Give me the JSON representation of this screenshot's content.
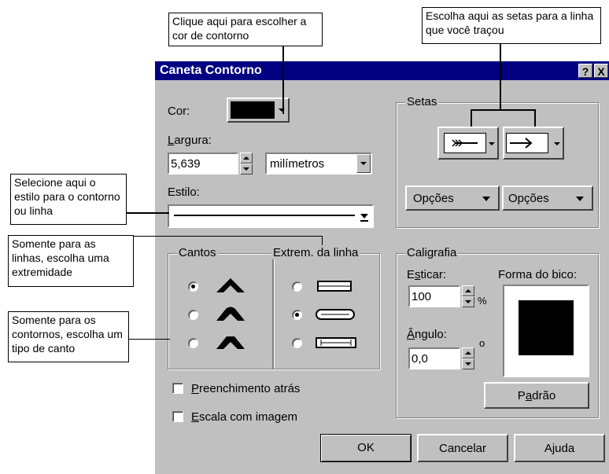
{
  "callouts": {
    "color": "Clique aqui para escolher a cor de contorno",
    "arrows": "Escolha aqui as setas para a linha que você traçou",
    "style": "Selecione aqui o estilo para o contorno ou linha",
    "line_end": "Somente para as linhas, escolha uma extremidade",
    "corner": "Somente para os contornos, escolha um tipo de canto"
  },
  "dialog": {
    "title": "Caneta Contorno",
    "help_btn": "?",
    "close_btn": "X",
    "color_label": "Cor:",
    "color_value": "#000000",
    "width_label": "Largura:",
    "width_value": "5,639",
    "width_unit": "milímetros",
    "style_label": "Estilo:",
    "arrows": {
      "group_label": "Setas",
      "options_left": "Opções",
      "options_right": "Opções"
    },
    "corners": {
      "group_label": "Cantos",
      "selected_index": 0
    },
    "line_ends": {
      "group_label": "Extrem. da linha",
      "selected_index": 1
    },
    "fill_behind": "Preenchimento atrás",
    "scale_with_image": "Escala com imagem",
    "calligraphy": {
      "group_label": "Caligrafia",
      "stretch_label": "Esticar:",
      "stretch_value": "100",
      "stretch_unit": "%",
      "angle_label": "Ângulo:",
      "angle_value": "0,0",
      "angle_unit": "o",
      "nib_label": "Forma do bico:",
      "default_btn": "Padrão"
    },
    "ok": "OK",
    "cancel": "Cancelar",
    "help": "Ajuda"
  }
}
